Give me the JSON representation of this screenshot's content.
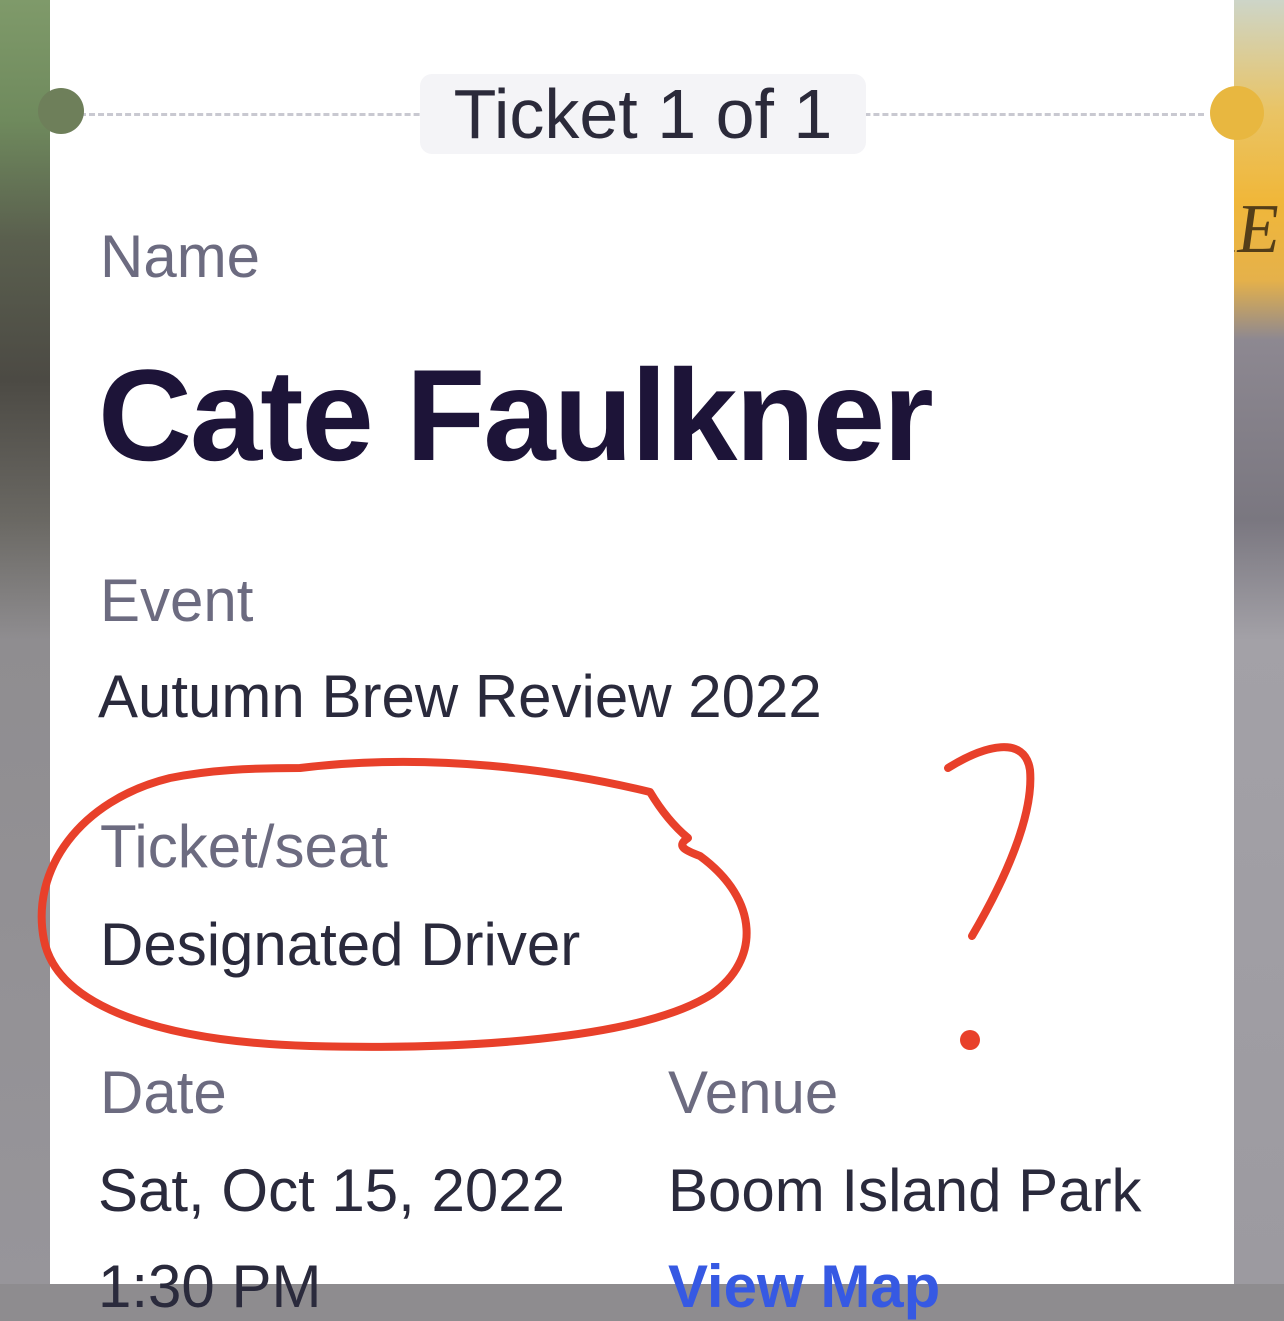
{
  "ticket": {
    "count_label": "Ticket 1 of 1"
  },
  "fields": {
    "name_label": "Name",
    "name_value": "Cate Faulkner",
    "event_label": "Event",
    "event_value": "Autumn Brew Review 2022",
    "seat_label": "Ticket/seat",
    "seat_value": "Designated Driver",
    "date_label": "Date",
    "date_value": "Sat, Oct 15, 2022",
    "time_value": "1:30 PM",
    "venue_label": "Venue",
    "venue_value": "Boom Island Park",
    "view_map_label": "View Map"
  },
  "annotation": {
    "color": "#e8402a",
    "mark": "?"
  },
  "background": {
    "right_text": "RE"
  }
}
